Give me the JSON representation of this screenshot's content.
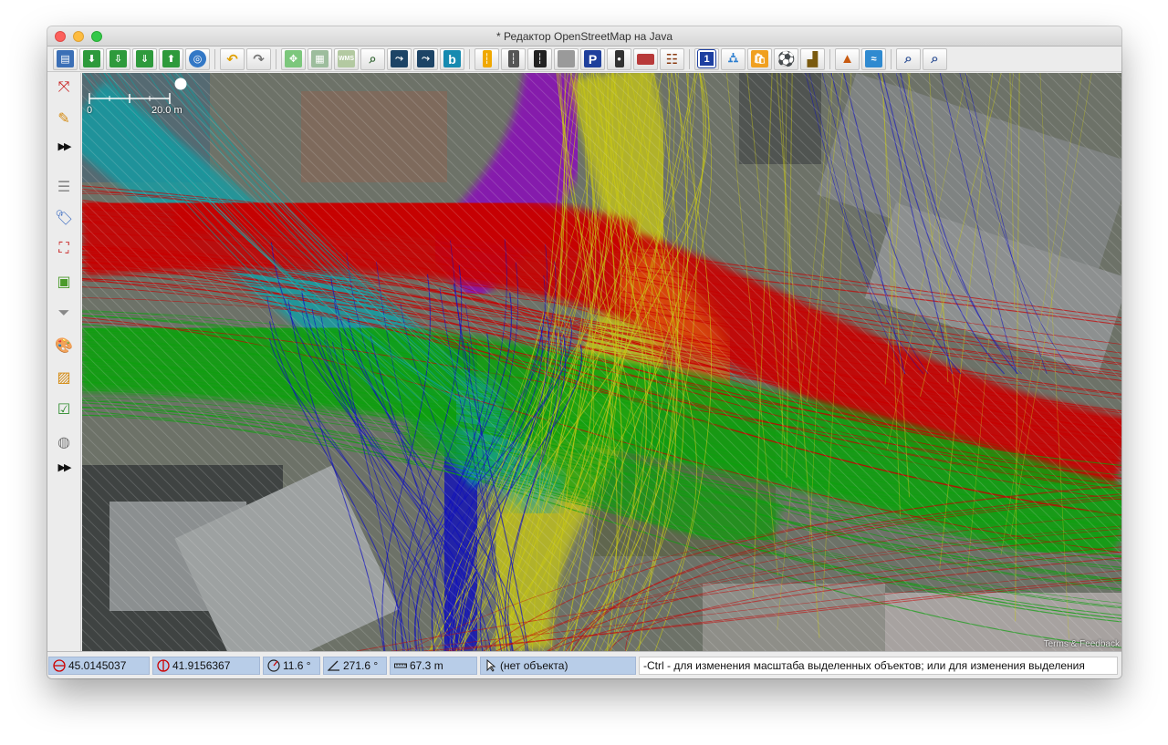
{
  "window": {
    "title": "* Редактор OpenStreetMap на Java"
  },
  "toolbar": {
    "groups": [
      [
        "open-file-icon",
        "download-icon",
        "download-selection-icon",
        "update-data-icon",
        "upload-icon",
        "validator-icon"
      ],
      [
        "undo-icon",
        "redo-icon"
      ],
      [
        "tms-imagery-icon",
        "wms-imagery-icon",
        "wms-tms-icon",
        "zoom-imagery-icon",
        "road-preset-icon",
        "track-preset-icon",
        "bing-imagery-icon"
      ],
      [
        "lane-icon",
        "road-icon",
        "railway-icon",
        "barrier-icon",
        "parking-icon",
        "traffic-signal-icon",
        "wall-icon",
        "rail-icon"
      ],
      [
        "route-number-icon",
        "hotel-icon",
        "shop-icon",
        "sport-icon",
        "industrial-icon"
      ],
      [
        "mountain-icon",
        "waterway-icon"
      ],
      [
        "zoom-in-icon",
        "zoom-out-icon"
      ]
    ],
    "labels": {
      "wms": "WMS",
      "parking": "P",
      "bing": "b",
      "route": "1"
    }
  },
  "sidebar": {
    "items": [
      "select-tool-icon",
      "draw-tool-icon",
      "more-tools-icon",
      "layers-icon",
      "tags-icon",
      "relations-icon",
      "image-panel-icon",
      "filter-icon",
      "map-paint-icon",
      "changeset-icon",
      "validation-icon",
      "wiki-icon",
      "more-panels-icon"
    ],
    "more_label": "▶▶"
  },
  "map": {
    "scale_start": "0",
    "scale_end": "20.0 m",
    "attribution": "Terms & Feedback",
    "colors": {
      "red": "#c80000",
      "green": "#10a010",
      "yellow": "#c8c814",
      "blue": "#1010c0",
      "purple": "#8a10b8",
      "cyan": "#10a0a0",
      "orange": "#e06010"
    }
  },
  "statusbar": {
    "lat": "45.0145037",
    "lon": "41.9156367",
    "heading": "11.6 °",
    "angle": "271.6 °",
    "distance": "67.3 m",
    "object": "(нет объекта)",
    "help": "-Ctrl - для изменения масштаба выделенных объектов; или для изменения выделения"
  }
}
